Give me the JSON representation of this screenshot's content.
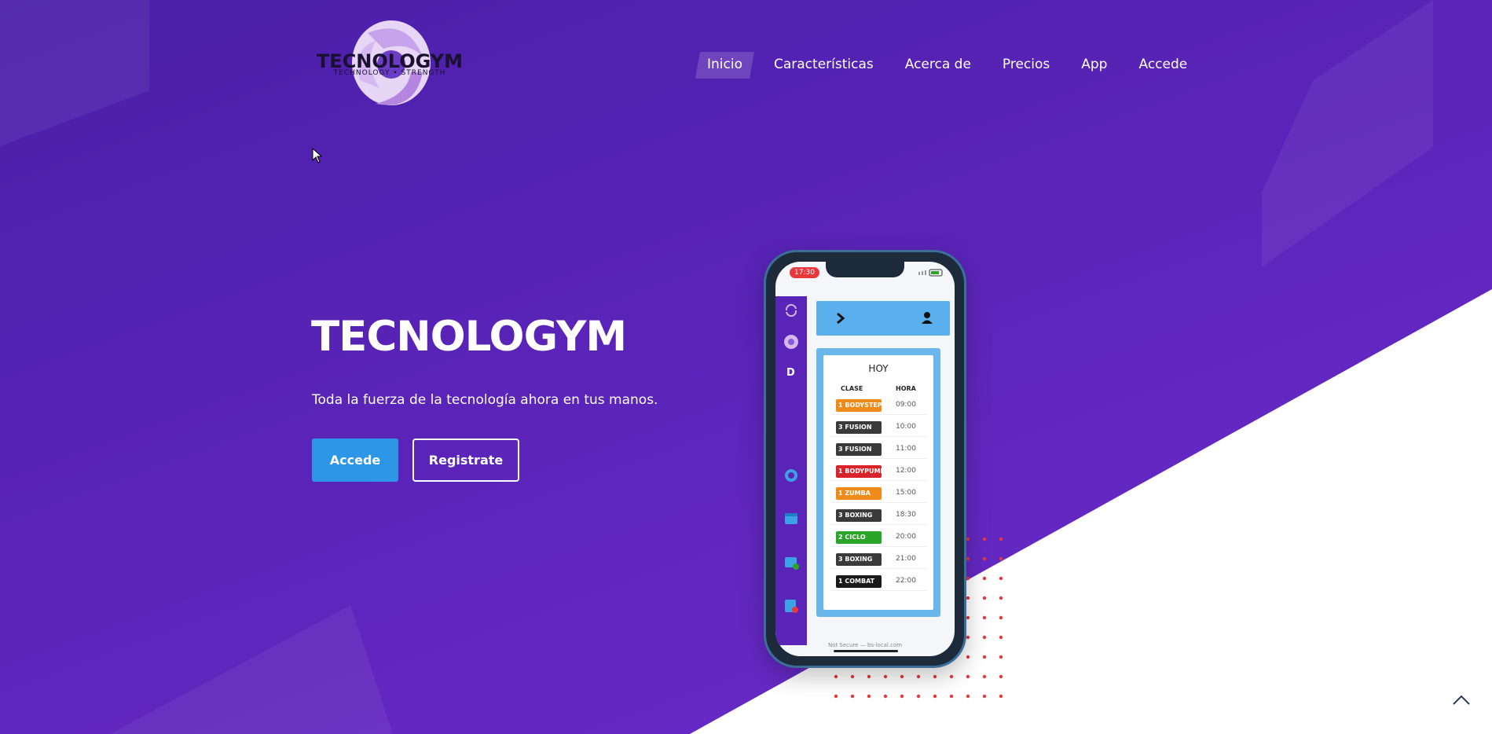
{
  "header": {
    "logo_text": "TECNOLOGYM",
    "logo_tagline": "TECHNOLOGY • STRENGTH",
    "nav": [
      {
        "label": "Inicio",
        "active": true
      },
      {
        "label": "Características",
        "active": false
      },
      {
        "label": "Acerca de",
        "active": false
      },
      {
        "label": "Precios",
        "active": false
      },
      {
        "label": "App",
        "active": false
      },
      {
        "label": "Accede",
        "active": false
      }
    ]
  },
  "hero": {
    "title": "TECNOLOGYM",
    "subtitle": "Toda la fuerza de la tecnología ahora en tus manos.",
    "primary_button": "Accede",
    "secondary_button": "Registrate"
  },
  "phone": {
    "time": "17:30",
    "panel_title": "HOY",
    "col_class": "CLASE",
    "col_time": "HORA",
    "rows": [
      {
        "num": "1",
        "name": "BODYSTEP",
        "time": "09:00",
        "color": "#f08a1a"
      },
      {
        "num": "3",
        "name": "FUSION",
        "time": "10:00",
        "color": "#3a3a3a"
      },
      {
        "num": "3",
        "name": "FUSION",
        "time": "11:00",
        "color": "#3a3a3a"
      },
      {
        "num": "1",
        "name": "BODYPUMP",
        "time": "12:00",
        "color": "#d8232a"
      },
      {
        "num": "1",
        "name": "ZUMBA",
        "time": "15:00",
        "color": "#f08a1a"
      },
      {
        "num": "3",
        "name": "BOXING",
        "time": "18:30",
        "color": "#3a3a3a"
      },
      {
        "num": "2",
        "name": "CICLO",
        "time": "20:00",
        "color": "#2aa52a"
      },
      {
        "num": "3",
        "name": "BOXING",
        "time": "21:00",
        "color": "#3a3a3a"
      },
      {
        "num": "1",
        "name": "COMBAT",
        "time": "22:00",
        "color": "#1a1a1a"
      }
    ],
    "url": "Not Secure — bs-local.com"
  },
  "icons": {
    "scroll_top": "chevron-up-icon"
  },
  "colors": {
    "brand_purple": "#5a24b8",
    "primary_button": "#2e96e6",
    "accent_dots": "#e8383d"
  }
}
